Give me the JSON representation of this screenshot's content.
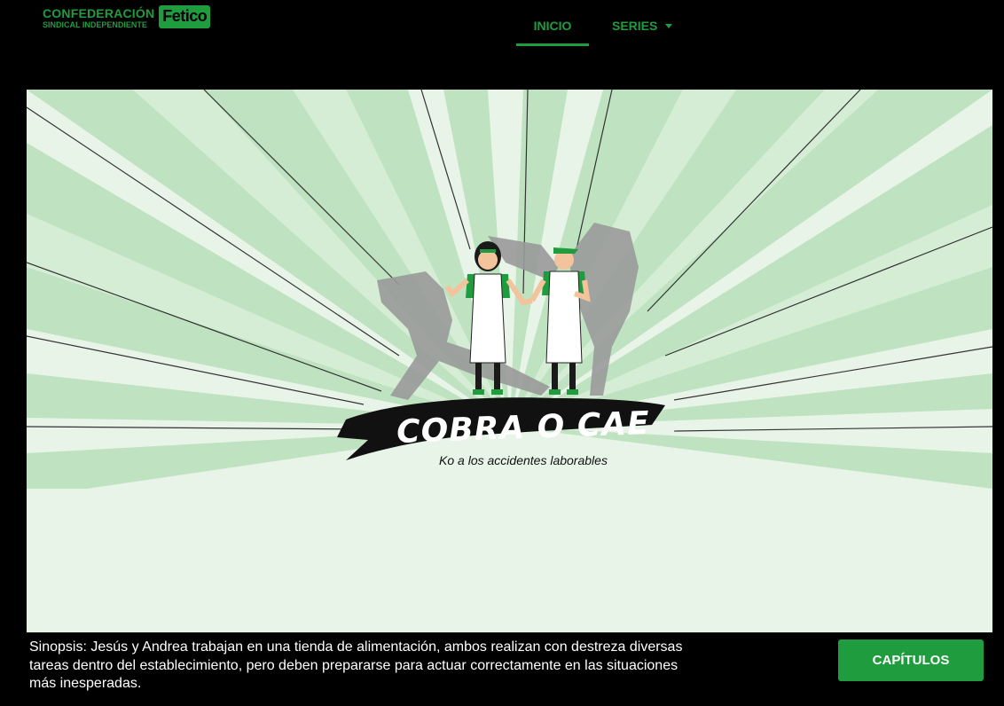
{
  "header": {
    "logo": {
      "line1": "CONFEDERACIÓN",
      "line2": "SINDICAL INDEPENDIENTE",
      "badge": "Fetico"
    },
    "nav": {
      "inicio": "INICIO",
      "series": "SERIES",
      "active": "INICIO"
    }
  },
  "hero": {
    "title": "COBRA O CAE",
    "subtitle": "Ko a los accidentes laborables"
  },
  "footer": {
    "synopsis": "Sinopsis: Jesús y Andrea trabajan en una tienda de alimentación, ambos realizan con destreza diversas tareas dentro del establecimiento, pero deben prepararse para actuar correctamente en las situaciones más inesperadas.",
    "chapters_button": "CAPÍTULOS"
  },
  "colors": {
    "brand_green": "#1f9d3e",
    "background": "#000000",
    "hero_bg": "#e8f4e7"
  }
}
